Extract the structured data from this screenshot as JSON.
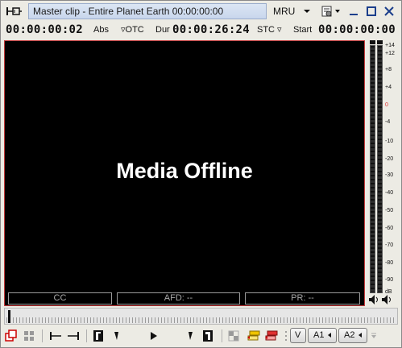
{
  "window": {
    "title": "Master clip - Entire Planet Earth 00:00:00:00",
    "mru_label": "MRU"
  },
  "timecode_bar": {
    "position": "00:00:00:02",
    "position_mode": "Abs",
    "otc_label": "OTC",
    "dur_label": "Dur",
    "duration": "00:00:26:24",
    "stc_label": "STC",
    "start_label": "Start",
    "start": "00:00:00:00"
  },
  "monitor": {
    "message": "Media Offline",
    "cc_label": "CC",
    "afd_label": "AFD: --",
    "pr_label": "PR: --"
  },
  "meter": {
    "scale": [
      "+14",
      "+12",
      "+8",
      "+4",
      "0",
      "-4",
      "-10",
      "-20",
      "-30",
      "-40",
      "-50",
      "-60",
      "-70",
      "-80",
      "-90",
      "dB"
    ],
    "zero_color": "#e03030"
  },
  "toolbar": {
    "tracks": [
      "V",
      "A1",
      "A2"
    ]
  }
}
